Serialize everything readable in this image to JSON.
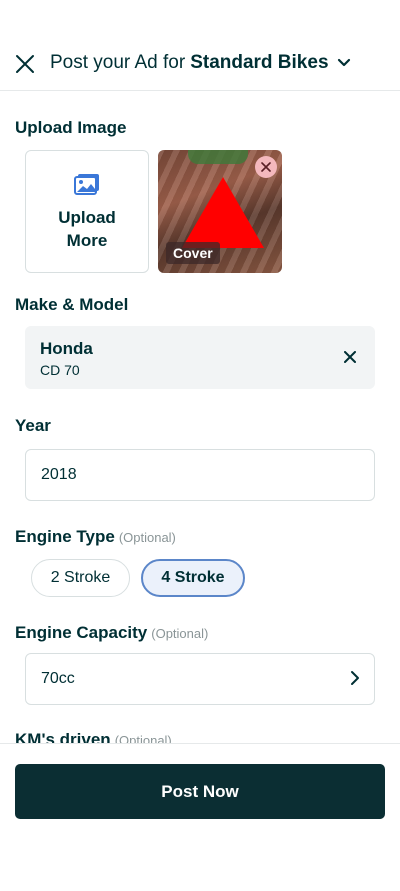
{
  "header": {
    "title_prefix": "Post your Ad for",
    "category": "Standard Bikes"
  },
  "upload": {
    "label": "Upload Image",
    "button_line1": "Upload",
    "button_line2": "More",
    "cover_badge": "Cover"
  },
  "make_model": {
    "label": "Make & Model",
    "make": "Honda",
    "model": "CD 70"
  },
  "year": {
    "label": "Year",
    "value": "2018"
  },
  "engine_type": {
    "label": "Engine Type",
    "optional": "(Optional)",
    "options": [
      "2 Stroke",
      "4 Stroke"
    ],
    "selected": "4 Stroke"
  },
  "engine_capacity": {
    "label": "Engine Capacity",
    "optional": "(Optional)",
    "value": "70cc"
  },
  "km_driven": {
    "label": "KM's driven",
    "optional": "(Optional)"
  },
  "footer": {
    "post_label": "Post Now"
  },
  "colors": {
    "primary": "#002f34",
    "button_bg": "#0b2e33",
    "selected_border": "#5b86c9",
    "selected_bg": "#ebf1fb",
    "image_icon": "#3a77d8"
  },
  "icons": {
    "close": "close-icon",
    "dropdown": "chevron-down-icon",
    "upload": "image-icon",
    "remove": "close-icon",
    "arrow": "chevron-right-icon"
  }
}
